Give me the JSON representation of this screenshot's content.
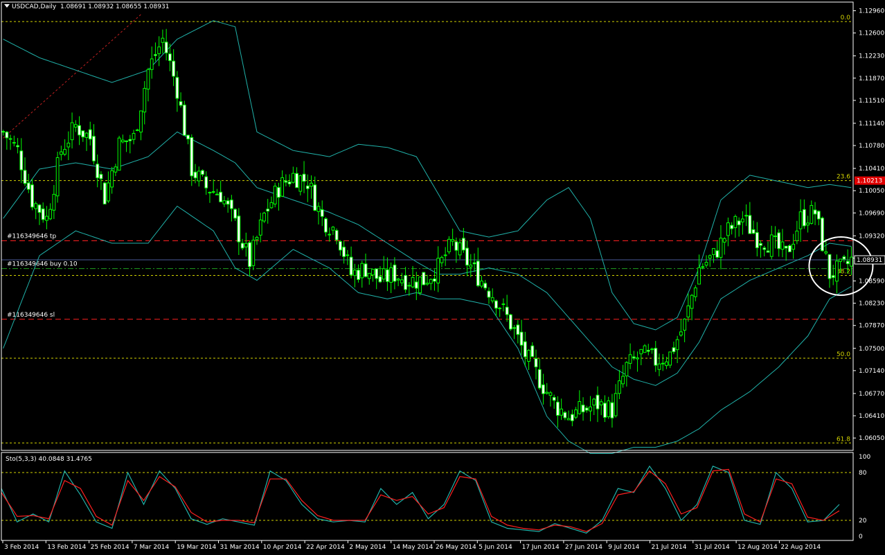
{
  "header": {
    "symbol": "USDCAD,Daily",
    "ohlc": "1.08691 1.08932 1.08655 1.08931"
  },
  "colors": {
    "background": "#000000",
    "bull_candle": "#00ff00",
    "bear_candle": "#ffffff",
    "bollinger": "#20b2aa",
    "fib": "#d4d400",
    "order_line": "#ff2020",
    "price_line": "#4a5a9a",
    "stoch_main": "#20b2aa",
    "stoch_signal": "#ff2020",
    "current_price_tag": "#e00000"
  },
  "chart_data": [
    {
      "type": "candlestick",
      "symbol": "USDCAD",
      "timeframe": "Daily",
      "ylim": [
        1.0585,
        1.131
      ],
      "y_ticks": [
        "1.12960",
        "1.12600",
        "1.12230",
        "1.11870",
        "1.11510",
        "1.11140",
        "1.10780",
        "1.10410",
        "1.10050",
        "1.09690",
        "1.09320",
        "1.08960",
        "1.08590",
        "1.08230",
        "1.07870",
        "1.07500",
        "1.07140",
        "1.06770",
        "1.06410",
        "1.06050"
      ],
      "x_tick_labels": [
        "3 Feb 2014",
        "13 Feb 2014",
        "25 Feb 2014",
        "7 Mar 2014",
        "19 Mar 2014",
        "31 Mar 2014",
        "10 Apr 2014",
        "22 Apr 2014",
        "2 May 2014",
        "14 May 2014",
        "26 May 2014",
        "5 Jun 2014",
        "17 Jun 2014",
        "27 Jun 2014",
        "9 Jul 2014",
        "21 Jul 2014",
        "31 Jul 2014",
        "12 Aug 2014",
        "22 Aug 2014"
      ],
      "close_keypoints": [
        [
          0,
          1.11
        ],
        [
          4,
          1.107
        ],
        [
          8,
          1.099
        ],
        [
          12,
          1.096
        ],
        [
          16,
          1.107
        ],
        [
          20,
          1.111
        ],
        [
          24,
          1.109
        ],
        [
          28,
          1.0995
        ],
        [
          32,
          1.108
        ],
        [
          36,
          1.109
        ],
        [
          40,
          1.12
        ],
        [
          44,
          1.125
        ],
        [
          48,
          1.117
        ],
        [
          52,
          1.104
        ],
        [
          56,
          1.101
        ],
        [
          60,
          1.1
        ],
        [
          64,
          1.095
        ],
        [
          68,
          1.089
        ],
        [
          72,
          1.0965
        ],
        [
          76,
          1.101
        ],
        [
          80,
          1.103
        ],
        [
          84,
          1.102
        ],
        [
          88,
          1.096
        ],
        [
          92,
          1.094
        ],
        [
          96,
          1.087
        ],
        [
          100,
          1.088
        ],
        [
          104,
          1.086
        ],
        [
          108,
          1.087
        ],
        [
          112,
          1.086
        ],
        [
          116,
          1.086
        ],
        [
          120,
          1.088
        ],
        [
          124,
          1.092
        ],
        [
          128,
          1.089
        ],
        [
          132,
          1.086
        ],
        [
          136,
          1.083
        ],
        [
          140,
          1.079
        ],
        [
          144,
          1.074
        ],
        [
          148,
          1.07
        ],
        [
          152,
          1.066
        ],
        [
          156,
          1.064
        ],
        [
          160,
          1.065
        ],
        [
          164,
          1.066
        ],
        [
          168,
          1.065
        ],
        [
          172,
          1.072
        ],
        [
          176,
          1.074
        ],
        [
          180,
          1.073
        ],
        [
          184,
          1.074
        ],
        [
          188,
          1.079
        ],
        [
          192,
          1.088
        ],
        [
          196,
          1.09
        ],
        [
          200,
          1.094
        ],
        [
          204,
          1.096
        ],
        [
          208,
          1.093
        ],
        [
          212,
          1.092
        ],
        [
          216,
          1.09
        ],
        [
          220,
          1.096
        ],
        [
          224,
          1.097
        ],
        [
          228,
          1.087
        ],
        [
          232,
          1.088
        ],
        [
          234,
          1.0893
        ]
      ],
      "bollinger": {
        "upper": [
          [
            0,
            1.125
          ],
          [
            10,
            1.122
          ],
          [
            20,
            1.12
          ],
          [
            30,
            1.118
          ],
          [
            40,
            1.12
          ],
          [
            48,
            1.125
          ],
          [
            58,
            1.128
          ],
          [
            64,
            1.127
          ],
          [
            70,
            1.11
          ],
          [
            80,
            1.107
          ],
          [
            90,
            1.106
          ],
          [
            98,
            1.108
          ],
          [
            106,
            1.1075
          ],
          [
            114,
            1.106
          ],
          [
            120,
            1.1
          ],
          [
            126,
            1.094
          ],
          [
            134,
            1.093
          ],
          [
            142,
            1.094
          ],
          [
            150,
            1.099
          ],
          [
            156,
            1.101
          ],
          [
            162,
            1.096
          ],
          [
            168,
            1.084
          ],
          [
            174,
            1.079
          ],
          [
            180,
            1.078
          ],
          [
            186,
            1.08
          ],
          [
            192,
            1.088
          ],
          [
            198,
            1.099
          ],
          [
            206,
            1.103
          ],
          [
            214,
            1.102
          ],
          [
            222,
            1.101
          ],
          [
            228,
            1.1015
          ],
          [
            234,
            1.101
          ]
        ],
        "middle": [
          [
            0,
            1.096
          ],
          [
            10,
            1.104
          ],
          [
            20,
            1.105
          ],
          [
            30,
            1.104
          ],
          [
            40,
            1.106
          ],
          [
            48,
            1.11
          ],
          [
            58,
            1.107
          ],
          [
            64,
            1.105
          ],
          [
            70,
            1.101
          ],
          [
            80,
            1.099
          ],
          [
            90,
            1.097
          ],
          [
            98,
            1.095
          ],
          [
            106,
            1.092
          ],
          [
            114,
            1.089
          ],
          [
            120,
            1.087
          ],
          [
            126,
            1.087
          ],
          [
            134,
            1.088
          ],
          [
            142,
            1.087
          ],
          [
            150,
            1.084
          ],
          [
            156,
            1.08
          ],
          [
            162,
            1.076
          ],
          [
            168,
            1.072
          ],
          [
            174,
            1.07
          ],
          [
            180,
            1.069
          ],
          [
            186,
            1.071
          ],
          [
            192,
            1.076
          ],
          [
            198,
            1.083
          ],
          [
            206,
            1.086
          ],
          [
            214,
            1.088
          ],
          [
            222,
            1.09
          ],
          [
            228,
            1.092
          ],
          [
            234,
            1.0915
          ]
        ],
        "lower": [
          [
            0,
            1.075
          ],
          [
            10,
            1.09
          ],
          [
            20,
            1.094
          ],
          [
            30,
            1.092
          ],
          [
            40,
            1.092
          ],
          [
            48,
            1.098
          ],
          [
            58,
            1.094
          ],
          [
            64,
            1.088
          ],
          [
            70,
            1.086
          ],
          [
            80,
            1.091
          ],
          [
            90,
            1.088
          ],
          [
            98,
            1.084
          ],
          [
            106,
            1.083
          ],
          [
            114,
            1.084
          ],
          [
            120,
            1.083
          ],
          [
            126,
            1.083
          ],
          [
            134,
            1.082
          ],
          [
            142,
            1.075
          ],
          [
            150,
            1.064
          ],
          [
            156,
            1.06
          ],
          [
            162,
            1.058
          ],
          [
            168,
            1.058
          ],
          [
            174,
            1.059
          ],
          [
            180,
            1.059
          ],
          [
            186,
            1.06
          ],
          [
            192,
            1.062
          ],
          [
            198,
            1.065
          ],
          [
            206,
            1.068
          ],
          [
            214,
            1.072
          ],
          [
            222,
            1.077
          ],
          [
            228,
            1.083
          ],
          [
            234,
            1.085
          ]
        ]
      },
      "fibonacci_levels": [
        {
          "label": "0.0",
          "price": 1.12785
        },
        {
          "label": "23.6",
          "price": 1.10213
        },
        {
          "label": "38.2",
          "price": 1.0868
        },
        {
          "label": "50.0",
          "price": 1.0734
        },
        {
          "label": "61.8",
          "price": 1.0597
        }
      ],
      "fib_trendline": {
        "from": [
          0,
          1.109
        ],
        "to": [
          38,
          1.129
        ]
      },
      "orders": [
        {
          "label": "#116349646 tp",
          "price": 1.0924,
          "style": "red-dash"
        },
        {
          "label": "#116349646 buy 0.10",
          "price": 1.0879,
          "style": "green-dashdot"
        },
        {
          "label": "#116349646 sl",
          "price": 1.0797,
          "style": "red-dash"
        }
      ],
      "current_price": {
        "value": 1.08931,
        "label": "1.08931"
      },
      "current_price_tag": {
        "value": 1.10213,
        "label": "1.10213"
      },
      "highlight_circle": {
        "bar": 230,
        "price": 1.0883
      }
    },
    {
      "type": "line",
      "name": "Sto(5,3,3)",
      "header": "Sto(5,3,3) 40.0848 31.4765",
      "ylim": [
        0,
        100
      ],
      "levels": [
        80,
        20
      ],
      "y_ticks": [
        "100",
        "80",
        "20",
        "0"
      ],
      "series": [
        {
          "values_keypoints": [
            [
              0,
              60
            ],
            [
              4,
              18
            ],
            [
              8,
              28
            ],
            [
              12,
              18
            ],
            [
              16,
              82
            ],
            [
              20,
              52
            ],
            [
              24,
              18
            ],
            [
              28,
              10
            ],
            [
              32,
              80
            ],
            [
              36,
              40
            ],
            [
              40,
              82
            ],
            [
              44,
              60
            ],
            [
              48,
              22
            ],
            [
              52,
              15
            ],
            [
              56,
              22
            ],
            [
              60,
              18
            ],
            [
              64,
              14
            ],
            [
              68,
              82
            ],
            [
              72,
              70
            ],
            [
              76,
              40
            ],
            [
              80,
              22
            ],
            [
              84,
              18
            ],
            [
              88,
              20
            ],
            [
              92,
              18
            ],
            [
              96,
              60
            ],
            [
              100,
              40
            ],
            [
              104,
              55
            ],
            [
              108,
              22
            ],
            [
              112,
              40
            ],
            [
              116,
              82
            ],
            [
              120,
              70
            ],
            [
              124,
              18
            ],
            [
              128,
              10
            ],
            [
              132,
              8
            ],
            [
              136,
              6
            ],
            [
              140,
              16
            ],
            [
              144,
              10
            ],
            [
              148,
              4
            ],
            [
              152,
              20
            ],
            [
              156,
              60
            ],
            [
              160,
              55
            ],
            [
              164,
              88
            ],
            [
              168,
              60
            ],
            [
              172,
              20
            ],
            [
              176,
              40
            ],
            [
              180,
              88
            ],
            [
              184,
              80
            ],
            [
              188,
              20
            ],
            [
              192,
              15
            ],
            [
              196,
              80
            ],
            [
              200,
              60
            ],
            [
              204,
              18
            ],
            [
              208,
              20
            ],
            [
              212,
              40
            ]
          ]
        },
        {
          "values_keypoints": [
            [
              0,
              55
            ],
            [
              4,
              25
            ],
            [
              8,
              26
            ],
            [
              12,
              22
            ],
            [
              16,
              70
            ],
            [
              20,
              60
            ],
            [
              24,
              25
            ],
            [
              28,
              14
            ],
            [
              32,
              70
            ],
            [
              36,
              45
            ],
            [
              40,
              75
            ],
            [
              44,
              62
            ],
            [
              48,
              30
            ],
            [
              52,
              18
            ],
            [
              56,
              20
            ],
            [
              60,
              20
            ],
            [
              64,
              17
            ],
            [
              68,
              72
            ],
            [
              72,
              72
            ],
            [
              76,
              45
            ],
            [
              80,
              26
            ],
            [
              84,
              20
            ],
            [
              88,
              20
            ],
            [
              92,
              20
            ],
            [
              96,
              52
            ],
            [
              100,
              45
            ],
            [
              104,
              50
            ],
            [
              108,
              28
            ],
            [
              112,
              36
            ],
            [
              116,
              75
            ],
            [
              120,
              72
            ],
            [
              124,
              25
            ],
            [
              128,
              14
            ],
            [
              132,
              10
            ],
            [
              136,
              8
            ],
            [
              140,
              14
            ],
            [
              144,
              12
            ],
            [
              148,
              6
            ],
            [
              152,
              16
            ],
            [
              156,
              52
            ],
            [
              160,
              56
            ],
            [
              164,
              82
            ],
            [
              168,
              66
            ],
            [
              172,
              28
            ],
            [
              176,
              36
            ],
            [
              180,
              82
            ],
            [
              184,
              84
            ],
            [
              188,
              28
            ],
            [
              192,
              18
            ],
            [
              196,
              72
            ],
            [
              200,
              66
            ],
            [
              204,
              24
            ],
            [
              208,
              20
            ],
            [
              212,
              32
            ]
          ]
        }
      ]
    }
  ]
}
